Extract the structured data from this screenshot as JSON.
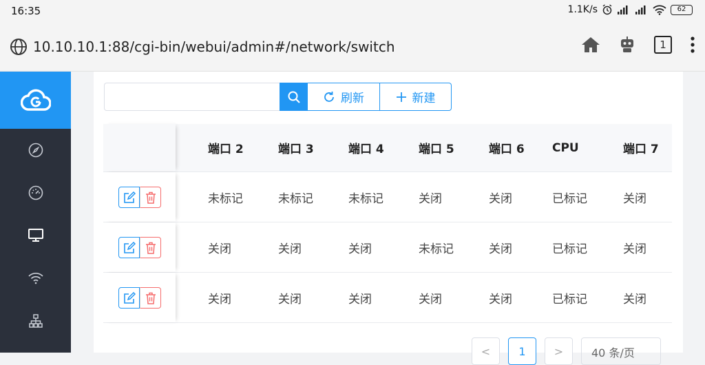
{
  "status_bar": {
    "time": "16:35",
    "speed": "1.1K/s",
    "battery": "62"
  },
  "browser": {
    "url": "10.10.10.1:88/cgi-bin/webui/admin#/network/switch",
    "tab_count": "1"
  },
  "toolbar": {
    "search_placeholder": "",
    "refresh_label": "刷新",
    "new_label": "新建"
  },
  "table": {
    "columns": [
      "端口 2",
      "端口 3",
      "端口 4",
      "端口 5",
      "端口 6",
      "CPU",
      "端口 7"
    ],
    "rows": [
      [
        "未标记",
        "未标记",
        "未标记",
        "关闭",
        "关闭",
        "已标记",
        "关闭"
      ],
      [
        "关闭",
        "关闭",
        "关闭",
        "未标记",
        "关闭",
        "已标记",
        "关闭"
      ],
      [
        "关闭",
        "关闭",
        "关闭",
        "关闭",
        "关闭",
        "已标记",
        "关闭"
      ]
    ]
  },
  "pagination": {
    "prev": "<",
    "current_page": "1",
    "next": ">",
    "page_size": "40 条/页"
  },
  "colors": {
    "accent": "#2196f3",
    "danger": "#f56c6c",
    "sidebar": "#2b303b"
  }
}
